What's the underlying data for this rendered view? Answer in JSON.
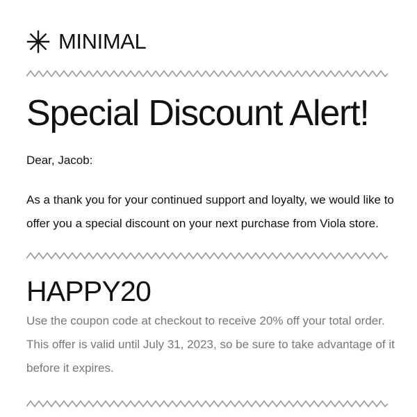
{
  "brand": {
    "icon": "asterisk-icon",
    "name": "MINIMAL"
  },
  "email": {
    "headline": "Special Discount Alert!",
    "greeting": "Dear, Jacob:",
    "message": "As a thank you for your continued support and loyalty, we would like to offer you a special discount on your next purchase from Viola store.",
    "coupon": {
      "code": "HAPPY20",
      "instruction": "Use the coupon code at checkout to receive 20% off your total order.",
      "validity": "This offer is valid until July 31, 2023, so be sure to take advantage of it before it expires."
    }
  },
  "divider": {
    "icon": "zigzag-divider",
    "color": "#9a9a9a"
  },
  "colors": {
    "text": "#111111",
    "muted_text": "#777777",
    "background": "#ffffff"
  }
}
